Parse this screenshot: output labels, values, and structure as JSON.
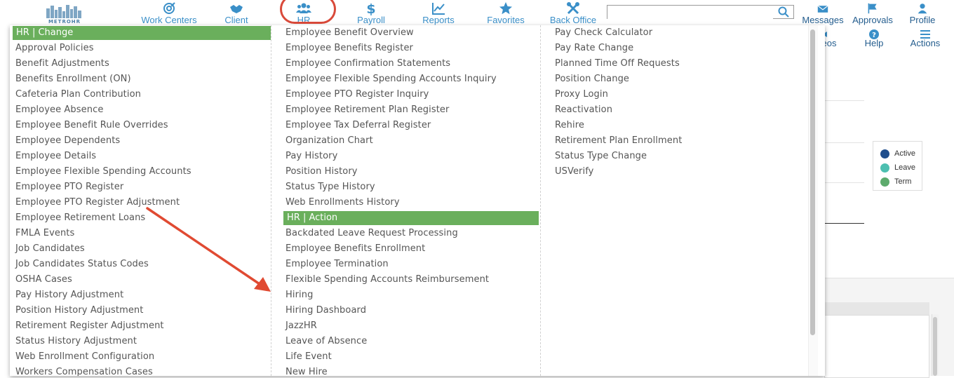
{
  "logo": {
    "text": "METROHR"
  },
  "nav": {
    "work_centers": "Work Centers",
    "client": "Client",
    "hr": "HR",
    "payroll": "Payroll",
    "reports": "Reports",
    "favorites": "Favorites",
    "back_office": "Back Office",
    "messages": "Messages",
    "approvals": "Approvals",
    "profile": "Profile"
  },
  "search": {
    "value": ""
  },
  "toolbar": {
    "videos": "eos",
    "help": "Help",
    "actions": "Actions"
  },
  "legend": {
    "items": [
      "Active",
      "Leave",
      "Term"
    ],
    "colors": [
      "#1f4e8c",
      "#4dbfb0",
      "#5caa6c"
    ]
  },
  "menu": {
    "col1": {
      "header": "HR | Change",
      "items": [
        "Approval Policies",
        "Benefit Adjustments",
        "Benefits Enrollment (ON)",
        "Cafeteria Plan Contribution",
        "Employee Absence",
        "Employee Benefit Rule Overrides",
        "Employee Dependents",
        "Employee Details",
        "Employee Flexible Spending Accounts",
        "Employee PTO Register",
        "Employee PTO Register Adjustment",
        "Employee Retirement Loans",
        "FMLA Events",
        "Job Candidates",
        "Job Candidates Status Codes",
        "OSHA Cases",
        "Pay History Adjustment",
        "Position History Adjustment",
        "Retirement Register Adjustment",
        "Status History Adjustment",
        "Web Enrollment Configuration",
        "Workers Compensation Cases"
      ]
    },
    "col2": {
      "items_top": [
        "Employee Benefit Overview",
        "Employee Benefits Register",
        "Employee Confirmation Statements",
        "Employee Flexible Spending Accounts Inquiry",
        "Employee PTO Register Inquiry",
        "Employee Retirement Plan Register",
        "Employee Tax Deferral Register",
        "Organization Chart",
        "Pay History",
        "Position History",
        "Status Type History",
        "Web Enrollments History"
      ],
      "header": "HR | Action",
      "items_bottom": [
        "Backdated Leave Request Processing",
        "Employee Benefits Enrollment",
        "Employee Termination",
        "Flexible Spending Accounts Reimbursement",
        "Hiring",
        "Hiring Dashboard",
        "JazzHR",
        "Leave of Absence",
        "Life Event",
        "New Hire"
      ]
    },
    "col3": {
      "items": [
        "Pay Check Calculator",
        "Pay Rate Change",
        "Planned Time Off Requests",
        "Position Change",
        "Proxy Login",
        "Reactivation",
        "Rehire",
        "Retirement Plan Enrollment",
        "Status Type Change",
        "USVerify"
      ]
    }
  },
  "colors": {
    "accent_green": "#6aaf5c",
    "nav_blue": "#3a8fc8",
    "annotation_red": "#e04a32"
  }
}
